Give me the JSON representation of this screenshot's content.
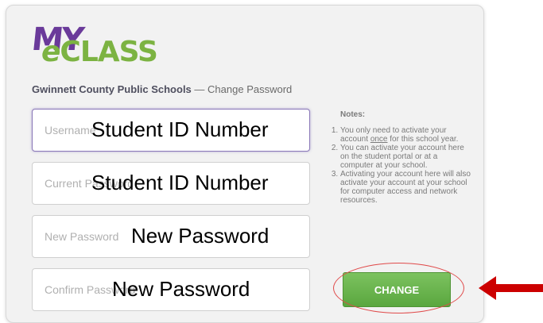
{
  "logo": {
    "text_my": "MY",
    "text_e": "e",
    "text_class": "CLASS"
  },
  "heading": {
    "school": "Gwinnett County Public Schools",
    "separator": "—",
    "page": "Change Password"
  },
  "fields": [
    {
      "placeholder": "Username",
      "value": "Student ID Number"
    },
    {
      "placeholder": "Current Password",
      "value": "Student ID Number"
    },
    {
      "placeholder": "New Password",
      "value": "New Password"
    },
    {
      "placeholder": "Confirm Password",
      "value": "New Password"
    }
  ],
  "notes": {
    "title": "Notes:",
    "items": [
      {
        "before": "You only need to activate your account ",
        "underlined": "once",
        "after": " for this school year."
      },
      {
        "text": "You can activate your account here on the student portal or at a computer at your school."
      },
      {
        "text": "Activating your account here will also activate your account at your school for computer access and network resources."
      }
    ]
  },
  "change_button": {
    "label": "CHANGE"
  },
  "colors": {
    "logo_purple": "#6a3a9a",
    "logo_green": "#7cb342",
    "button_green": "#5aa73f",
    "annotation_red": "#cc0000"
  }
}
